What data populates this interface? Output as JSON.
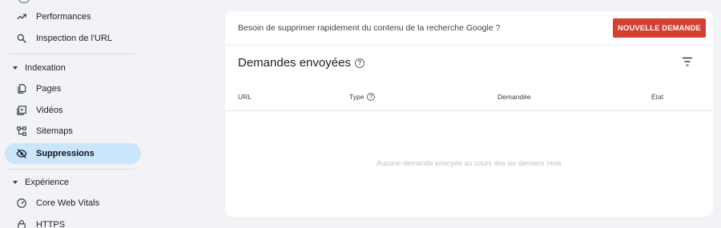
{
  "sidebar": {
    "items_top": [
      {
        "label": "Performances",
        "icon": "trending-up-icon"
      },
      {
        "label": "Inspection de l'URL",
        "icon": "search-icon"
      }
    ],
    "sections": [
      {
        "title": "Indexation",
        "items": [
          {
            "label": "Pages",
            "icon": "pages-icon"
          },
          {
            "label": "Vidéos",
            "icon": "video-icon"
          },
          {
            "label": "Sitemaps",
            "icon": "sitemap-icon"
          },
          {
            "label": "Suppressions",
            "icon": "eye-off-icon",
            "active": true
          }
        ]
      },
      {
        "title": "Expérience",
        "items": [
          {
            "label": "Core Web Vitals",
            "icon": "gauge-icon"
          },
          {
            "label": "HTTPS",
            "icon": "lock-icon"
          }
        ]
      }
    ]
  },
  "card": {
    "prompt": "Besoin de supprimer rapidement du contenu de la recherche Google ?",
    "new_request_label": "NOUVELLE DEMANDE",
    "title": "Demandes envoyées",
    "columns": [
      "URL",
      "Type",
      "Demandée",
      "État"
    ],
    "empty_message": "Aucune demande envoyée au cours des six derniers mois"
  },
  "colors": {
    "accent_button": "#d23f31",
    "active_nav": "#c9e6fb",
    "background": "#f1f3f6"
  }
}
